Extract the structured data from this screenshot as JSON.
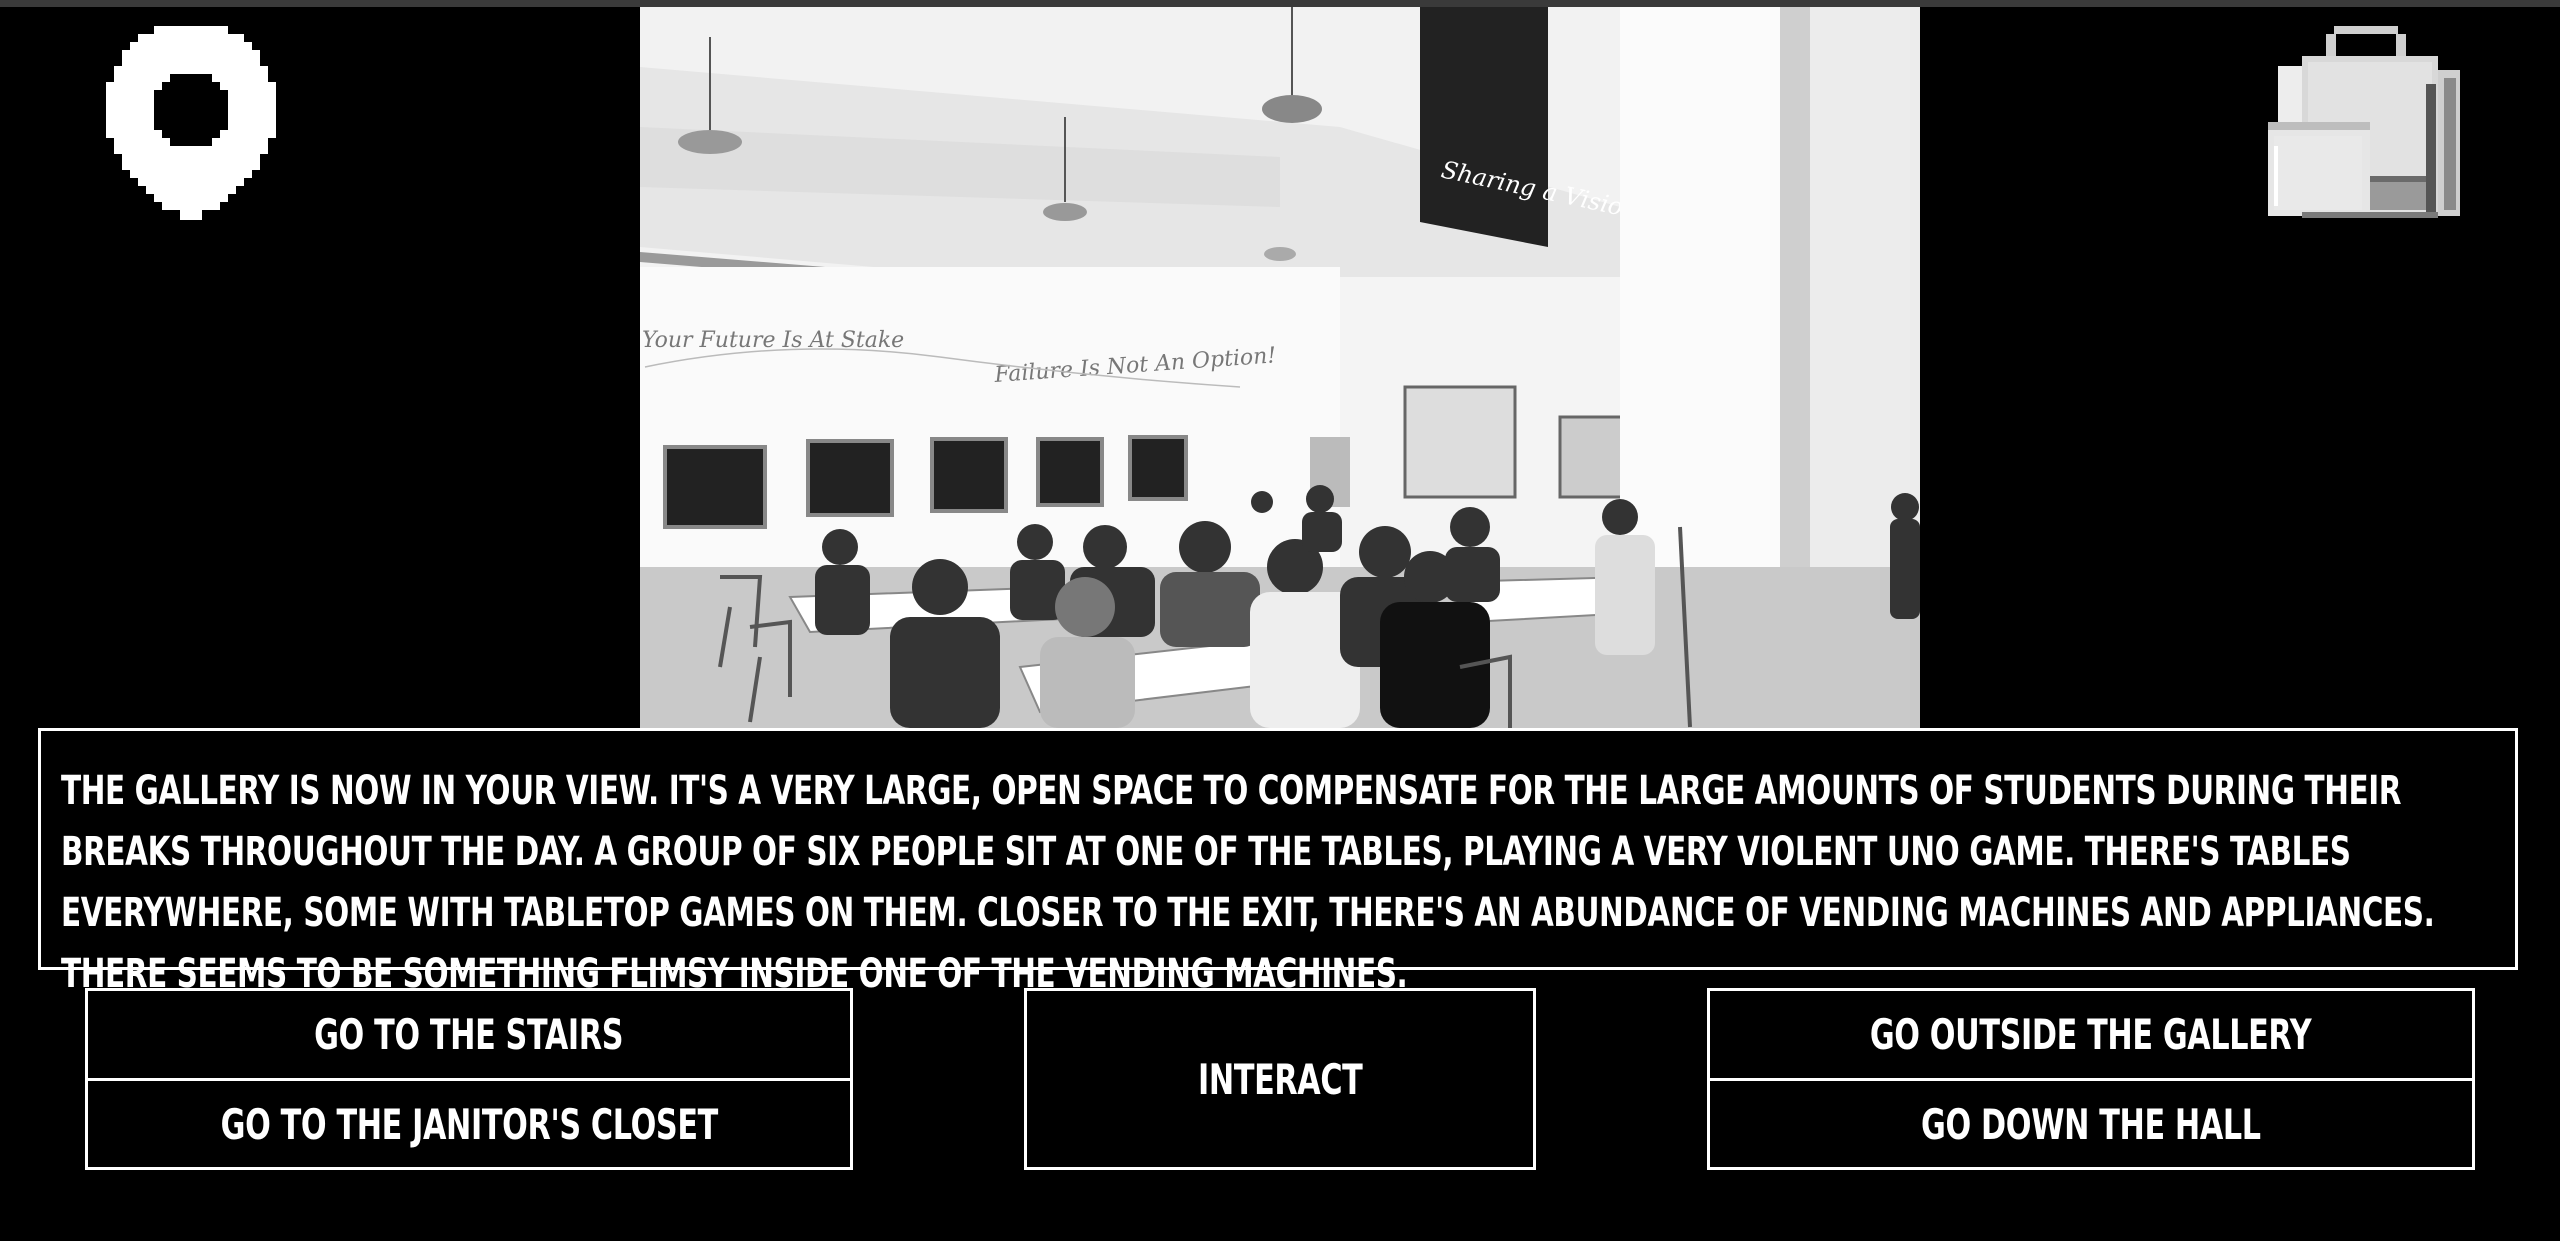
{
  "hud": {
    "map_icon": "map-pin-icon",
    "inventory_icon": "backpack-icon"
  },
  "scene": {
    "image": "cafeteria-gallery-photo",
    "wall_text_left": "Your Future Is At Stake",
    "wall_text_right": "Failure Is Not An Option!",
    "banner_text": "Sharing a Vision"
  },
  "narration": {
    "text": "The gallery is now in your view. It's a very large, open space to compensate for the large amounts of students during their breaks throughout the day. A group of six people sit at one of the tables, playing a very violent UNO game. There's tables everywhere, some with tabletop games on them. Closer to the exit, there's an abundance of vending machines and appliances. There seems to be something flimsy inside one of the vending machines."
  },
  "actions": {
    "stairs": "GO TO THE STAIRS",
    "janitor": "GO TO THE JANITOR'S CLOSET",
    "interact": "INTERACT",
    "outside": "GO OUTSIDE THE GALLERY",
    "hall": "GO DOWN THE HALL"
  },
  "colors": {
    "background": "#000000",
    "foreground": "#ffffff"
  }
}
